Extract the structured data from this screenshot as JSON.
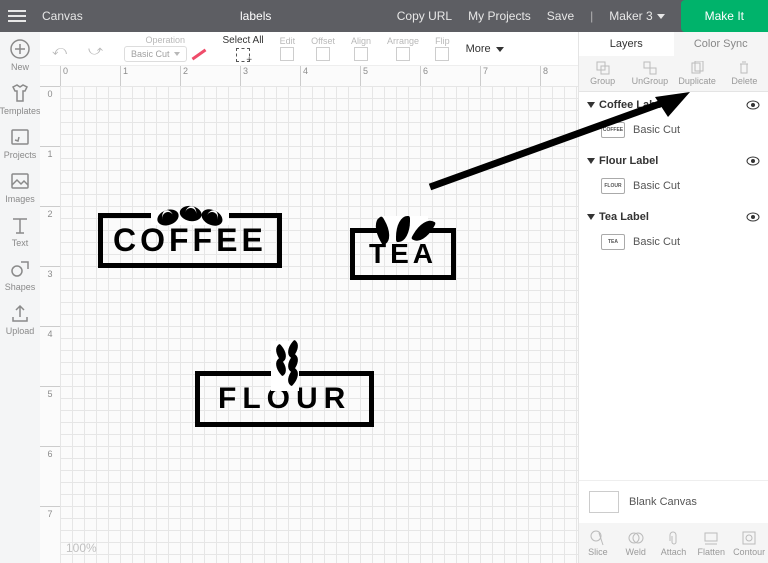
{
  "topbar": {
    "app": "Canvas",
    "project_title": "labels",
    "copy_url": "Copy URL",
    "my_projects": "My Projects",
    "save": "Save",
    "machine": "Maker 3",
    "make_it": "Make It"
  },
  "sidebar": [
    {
      "label": "New"
    },
    {
      "label": "Templates"
    },
    {
      "label": "Projects"
    },
    {
      "label": "Images"
    },
    {
      "label": "Text"
    },
    {
      "label": "Shapes"
    },
    {
      "label": "Upload"
    }
  ],
  "toolbar": {
    "operation_label": "Operation",
    "operation_value": "Basic Cut",
    "select_all": "Select All",
    "edit": "Edit",
    "offset": "Offset",
    "align": "Align",
    "arrange": "Arrange",
    "flip": "Flip",
    "more": "More"
  },
  "ruler_h": [
    "0",
    "1",
    "2",
    "3",
    "4",
    "5",
    "6",
    "7",
    "8"
  ],
  "ruler_v": [
    "0",
    "1",
    "2",
    "3",
    "4",
    "5",
    "6",
    "7"
  ],
  "zoom": "100%",
  "artwork": {
    "coffee": "COFFEE",
    "tea": "TEA",
    "flour": "FLOUR"
  },
  "panel": {
    "tabs": {
      "layers": "Layers",
      "color_sync": "Color Sync"
    },
    "tools": {
      "group": "Group",
      "ungroup": "UnGroup",
      "duplicate": "Duplicate",
      "delete": "Delete"
    },
    "layers": [
      {
        "name": "Coffee Label",
        "type": "Basic Cut",
        "thumb": "COFFEE"
      },
      {
        "name": "Flour Label",
        "type": "Basic Cut",
        "thumb": "FLOUR"
      },
      {
        "name": "Tea Label",
        "type": "Basic Cut",
        "thumb": "TEA"
      }
    ],
    "blank_canvas": "Blank Canvas",
    "footer": {
      "slice": "Slice",
      "weld": "Weld",
      "attach": "Attach",
      "flatten": "Flatten",
      "contour": "Contour"
    }
  }
}
